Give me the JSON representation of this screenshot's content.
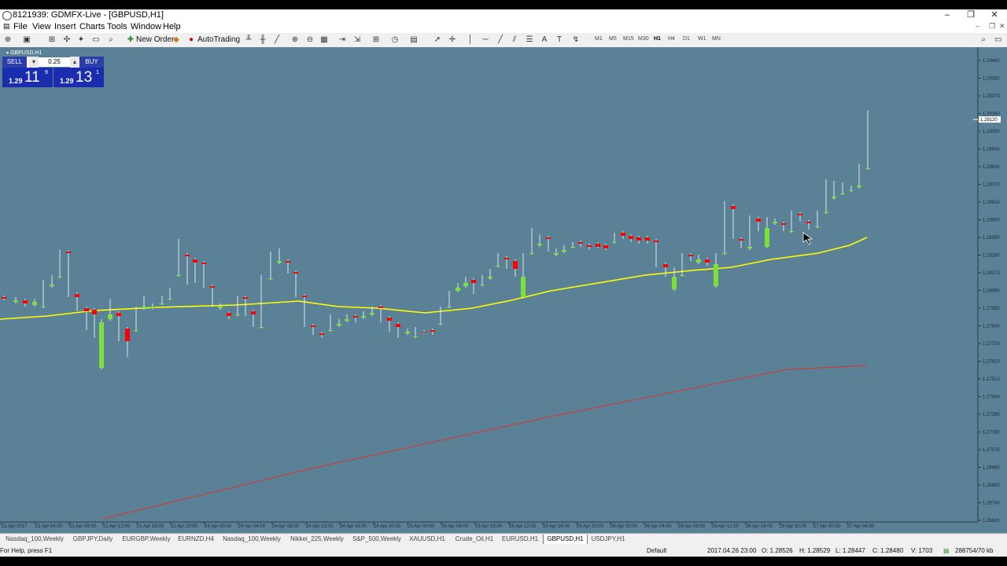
{
  "window": {
    "title": "8121939: GDMFX-Live - [GBPUSD,H1]",
    "minimize": "–",
    "restore": "❐",
    "close": "✕"
  },
  "menu": [
    "File",
    "View",
    "Insert",
    "Charts",
    "Tools",
    "Window",
    "Help"
  ],
  "toolbar": {
    "new_order": "New Order",
    "autotrading": "AutoTrading",
    "timeframes": [
      "M1",
      "M5",
      "M15",
      "M30",
      "H1",
      "H4",
      "D1",
      "W1",
      "MN"
    ],
    "active_timeframe": "H1"
  },
  "chart": {
    "label": "GBPUSD,H1",
    "background": "#5b8196",
    "bull_color": "#7be03a",
    "bear_color": "#ff0000",
    "ma_fast_color": "#ffff00",
    "ma_slow_color": "#e03030",
    "current_price_label": "1.29120",
    "price_ticks": [
      "1.29490",
      "1.29380",
      "1.29270",
      "1.29160",
      "1.29050",
      "1.28940",
      "1.28830",
      "1.28720",
      "1.28610",
      "1.28500",
      "1.28390",
      "1.28280",
      "1.28170",
      "1.28060",
      "1.27950",
      "1.27840",
      "1.27730",
      "1.27620",
      "1.27510",
      "1.27400",
      "1.27290",
      "1.27180",
      "1.27070",
      "1.26960",
      "1.26850",
      "1.26740",
      "1.26630"
    ],
    "time_ticks": [
      "21 Apr 2017",
      "21 Apr 04:00",
      "21 Apr 08:00",
      "21 Apr 12:00",
      "21 Apr 16:00",
      "21 Apr 20:00",
      "24 Apr 00:00",
      "24 Apr 04:00",
      "24 Apr 08:00",
      "24 Apr 12:00",
      "24 Apr 16:00",
      "24 Apr 20:00",
      "25 Apr 00:00",
      "25 Apr 04:00",
      "25 Apr 08:00",
      "25 Apr 12:00",
      "25 Apr 16:00",
      "25 Apr 20:00",
      "26 Apr 00:00",
      "26 Apr 04:00",
      "26 Apr 08:00",
      "26 Apr 12:00",
      "26 Apr 16:00",
      "26 Apr 20:00",
      "27 Apr 00:00",
      "27 Apr 04:00"
    ]
  },
  "trade_panel": {
    "sell_label": "SELL",
    "buy_label": "BUY",
    "lot": "0.25",
    "sell_small": "1.29",
    "sell_big": "11",
    "sell_sup": "9",
    "buy_small": "1.29",
    "buy_big": "13",
    "buy_sup": "1"
  },
  "tabs": [
    "Nasdaq_100,Weekly",
    "GBPJPY,Daily",
    "EURGBP,Weekly",
    "EURNZD,H4",
    "Nasdaq_100,Weekly",
    "Nikkei_225,Weekly",
    "S&P_500,Weekly",
    "XAUUSD,H1",
    "Crude_Oil,H1",
    "EURUSD,H1",
    "GBPUSD,H1",
    "USDJPY,H1"
  ],
  "active_tab": "GBPUSD,H1",
  "status": {
    "help": "For Help, press F1",
    "profile": "Default",
    "datetime": "2017.04.26 23:00",
    "open": "O: 1.28526",
    "high": "H: 1.28529",
    "low": "L: 1.28447",
    "close": "C: 1.28480",
    "volume": "V: 1703",
    "traffic": "288754/70 kb"
  }
}
